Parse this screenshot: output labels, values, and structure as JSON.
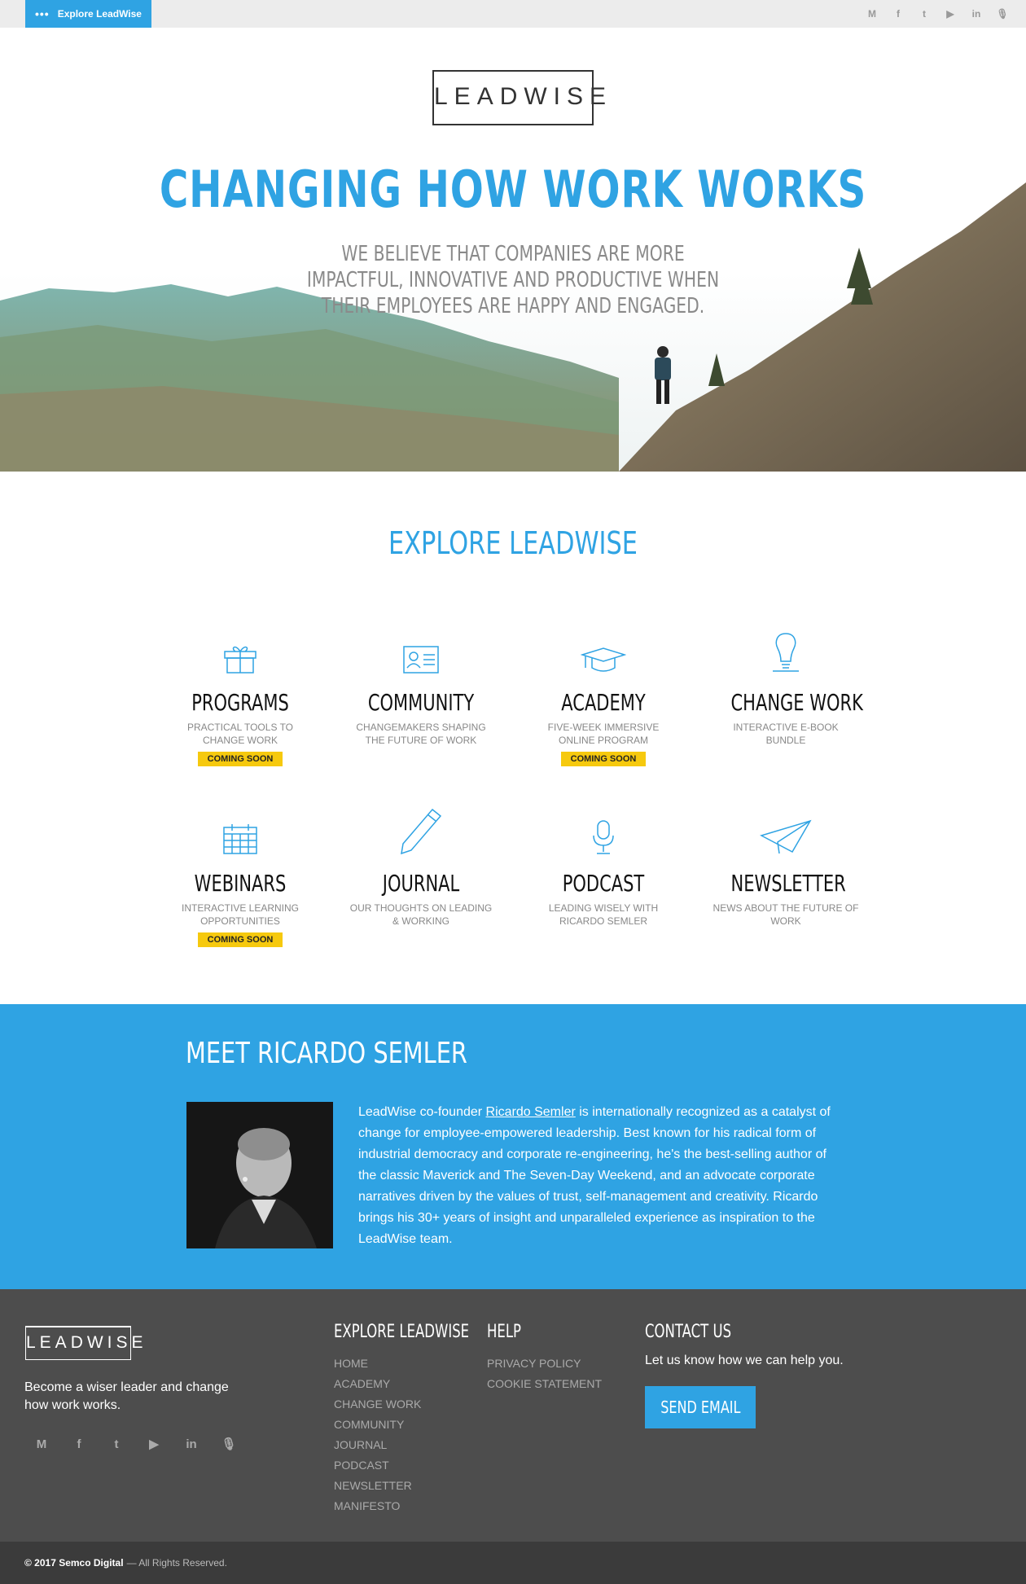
{
  "topbar": {
    "explore_label": "Explore LeadWise",
    "social": [
      "M",
      "f",
      "t",
      "▶",
      "in",
      "🎙"
    ]
  },
  "hero": {
    "logo": "LEADWISE",
    "title": "CHANGING HOW WORK WORKS",
    "subtitle": "WE BELIEVE THAT COMPANIES ARE MORE IMPACTFUL, INNOVATIVE AND PRODUCTIVE WHEN THEIR EMPLOYEES ARE HAPPY AND ENGAGED."
  },
  "explore": {
    "title": "EXPLORE LEADWISE",
    "cards": [
      {
        "title": "PROGRAMS",
        "desc": "PRACTICAL TOOLS TO CHANGE WORK",
        "badge": "COMING SOON",
        "icon": "gift-icon"
      },
      {
        "title": "COMMUNITY",
        "desc": "CHANGEMAKERS SHAPING THE FUTURE OF WORK",
        "badge": "",
        "icon": "id-card-icon"
      },
      {
        "title": "ACADEMY",
        "desc": "FIVE-WEEK IMMERSIVE ONLINE PROGRAM",
        "badge": "COMING SOON",
        "icon": "graduation-cap-icon"
      },
      {
        "title": "CHANGE WORK",
        "desc": "INTERACTIVE E-BOOK BUNDLE",
        "badge": "",
        "icon": "lightbulb-icon"
      },
      {
        "title": "WEBINARS",
        "desc": "INTERACTIVE LEARNING OPPORTUNITIES",
        "badge": "COMING SOON",
        "icon": "calendar-icon"
      },
      {
        "title": "JOURNAL",
        "desc": "OUR THOUGHTS ON LEADING & WORKING",
        "badge": "",
        "icon": "pencil-icon"
      },
      {
        "title": "PODCAST",
        "desc": "LEADING WISELY WITH RICARDO SEMLER",
        "badge": "",
        "icon": "microphone-icon"
      },
      {
        "title": "NEWSLETTER",
        "desc": "NEWS ABOUT THE FUTURE OF WORK",
        "badge": "",
        "icon": "paper-plane-icon"
      }
    ]
  },
  "meet": {
    "title": "MEET RICARDO SEMLER",
    "bio_before": "LeadWise co-founder ",
    "bio_link": "Ricardo Semler",
    "bio_after": " is internationally recognized as a catalyst of change for employee-empowered leadership. Best known for his radical form of industrial democracy and corporate re-engineering, he's the best-selling author of the classic Maverick and The Seven-Day Weekend, and an advocate corporate narratives driven by the values of trust, self-management and creativity. Ricardo brings his 30+ years of insight and unparalleled experience as inspiration to the LeadWise team."
  },
  "footer": {
    "logo": "LEADWISE",
    "tagline": "Become a wiser leader and change how work works.",
    "social": [
      "M",
      "f",
      "t",
      "▶",
      "in",
      "🎙"
    ],
    "explore_title": "EXPLORE LEADWISE",
    "explore_links": [
      "HOME",
      "ACADEMY",
      "CHANGE WORK",
      "COMMUNITY",
      "JOURNAL",
      "PODCAST",
      "NEWSLETTER",
      "MANIFESTO"
    ],
    "help_title": "HELP",
    "help_links": [
      "PRIVACY POLICY",
      "COOKIE STATEMENT"
    ],
    "contact_title": "CONTACT US",
    "contact_text": "Let us know how we can help you.",
    "send_label": "SEND EMAIL",
    "copyright_bold": "© 2017 Semco Digital",
    "copyright_rest": "— All Rights Reserved."
  },
  "colors": {
    "accent": "#2fa3e3",
    "badge": "#f6c90e",
    "footer": "#4d4d4d"
  }
}
